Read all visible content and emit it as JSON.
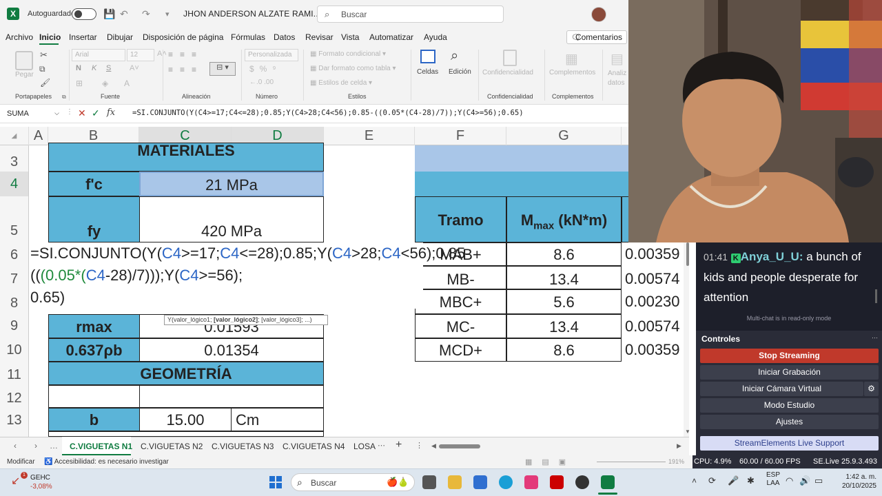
{
  "titlebar": {
    "autosave_label": "Autoguardado",
    "doc_title": "JHON ANDERSON ALZATE RAMI...",
    "search_placeholder": "Buscar"
  },
  "menu": {
    "items": [
      "Archivo",
      "Inicio",
      "Insertar",
      "Dibujar",
      "Disposición de página",
      "Fórmulas",
      "Datos",
      "Revisar",
      "Vista",
      "Automatizar",
      "Ayuda"
    ],
    "active": "Inicio",
    "comments": "Comentarios"
  },
  "ribbon": {
    "paste": "Pegar",
    "font_name": "Arial",
    "font_size": "12",
    "number_format": "Personalizada",
    "conditional_format": "Formato condicional",
    "table_format": "Dar formato como tabla",
    "cell_styles": "Estilos de celda",
    "cells": "Celdas",
    "edit": "Edición",
    "confidentiality": "Confidencialidad",
    "addins": "Complementos",
    "analyze": "Analiz datos",
    "groups": {
      "clipboard": "Portapapeles",
      "font": "Fuente",
      "alignment": "Alineación",
      "number": "Número",
      "styles": "Estilos",
      "confidentiality": "Confidencialidad",
      "addins": "Complementos"
    }
  },
  "formula_bar": {
    "name_box": "SUMA",
    "formula": "=SI.CONJUNTO(Y(C4>=17;C4<=28);0.85;Y(C4>28;C4<56);0.85-((0.05*(C4-28)/7));Y(C4>=56);0.65)"
  },
  "grid": {
    "columns": [
      "A",
      "B",
      "C",
      "D",
      "E",
      "F",
      "G"
    ],
    "rows": [
      "3",
      "4",
      "5",
      "6",
      "7",
      "8",
      "9",
      "10",
      "11",
      "12",
      "13"
    ],
    "materiales": "MATERIALES",
    "fc_label": "f'c",
    "fc_value": "21 MPa",
    "fy_label": "fy",
    "fy_value": "420 MPa",
    "rmax_label": "rmax",
    "rmax_value": "0.01593",
    "rpb_label": "0.637ρb",
    "rpb_value": "0.01354",
    "geometria": "GEOMETRÍA",
    "b_label": "b",
    "b_value": "15.00",
    "b_unit": "Cm",
    "tramo_header": "Tramo",
    "mmax_header_main": "M",
    "mmax_header_sub": "max",
    "mmax_header_unit": " (kN*m)",
    "tramos": [
      {
        "name": "MAB+",
        "m": "8.6",
        "r": "0.00359"
      },
      {
        "name": "MB-",
        "m": "13.4",
        "r": "0.00574"
      },
      {
        "name": "MBC+",
        "m": "5.6",
        "r": "0.00230"
      },
      {
        "name": "MC-",
        "m": "13.4",
        "r": "0.00574"
      },
      {
        "name": "MCD+",
        "m": "8.6",
        "r": "0.00359"
      }
    ],
    "edit_parts": {
      "p1": "=SI.CONJUNTO(Y(",
      "p2": "C4",
      "p3": ">=17;",
      "p4": "C4",
      "p5": "<=28);0.85;Y(",
      "p6": "C4",
      "p7": ">28;",
      "p8": "C4",
      "p9": "<56);0.85-((",
      "p10": "(0.05*(",
      "p11": "C4",
      "p12": "-28)/7)",
      "p13": "));Y(",
      "p14": "C4",
      "p15": ">=56);",
      "p16": "0.65)"
    },
    "tooltip_prefix": "Y(valor_lógico1; ",
    "tooltip_bold": "[valor_lógico2]",
    "tooltip_suffix": "; [valor_lógico3]; ...)"
  },
  "sheets": {
    "tabs": [
      "C.VIGUETAS N1",
      "C.VIGUETAS N2",
      "C.VIGUETAS N3",
      "C.VIGUETAS N4",
      "LOSA"
    ],
    "active": "C.VIGUETAS N1"
  },
  "status": {
    "mode": "Modificar",
    "accessibility": "Accesibilidad: es necesario investigar",
    "zoom": "191%"
  },
  "chat": {
    "time": "01:41",
    "user": "Anya_U_U:",
    "message": "a bunch of kids and people desperate for attention",
    "note": "Multi-chat is in read-only mode"
  },
  "controls": {
    "title": "Controles",
    "buttons": [
      "Stop Streaming",
      "Iniciar Grabación",
      "Iniciar Cámara Virtual",
      "Modo Estudio",
      "Ajustes",
      "StreamElements Live Support"
    ],
    "cpu": "CPU: 4.9%",
    "fps": "60.00 / 60.00 FPS",
    "version": "SE.Live 25.9.3.493"
  },
  "taskbar": {
    "stock_name": "GEHC",
    "stock_change": "-3,08%",
    "search": "Buscar",
    "lang1": "ESP",
    "lang2": "LAA",
    "time": "1:42 a. m.",
    "date": "20/10/2025"
  },
  "colors": {
    "excel_green": "#107c41",
    "header_blue": "#5bb4d8",
    "obs_red": "#c0392b"
  }
}
